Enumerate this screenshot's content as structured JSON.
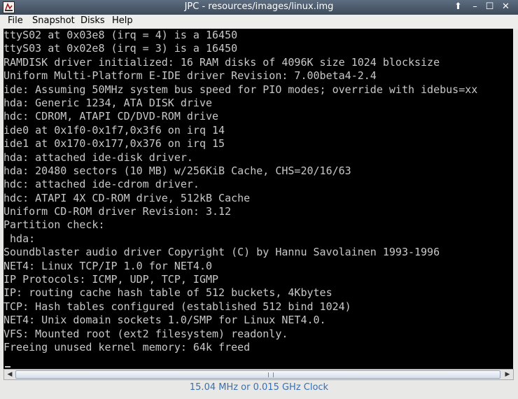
{
  "window": {
    "title": "JPC - resources/images/linux.img",
    "buttons": {
      "up": "⬆",
      "minimize": "–",
      "maximize": "☐",
      "close": "✕"
    }
  },
  "menu": {
    "file": "File",
    "snapshot": "Snapshot",
    "disks": "Disks",
    "help": "Help"
  },
  "console": {
    "lines": [
      "ttyS02 at 0x03e8 (irq = 4) is a 16450",
      "ttyS03 at 0x02e8 (irq = 3) is a 16450",
      "RAMDISK driver initialized: 16 RAM disks of 4096K size 1024 blocksize",
      "Uniform Multi-Platform E-IDE driver Revision: 7.00beta4-2.4",
      "ide: Assuming 50MHz system bus speed for PIO modes; override with idebus=xx",
      "hda: Generic 1234, ATA DISK drive",
      "hdc: CDROM, ATAPI CD/DVD-ROM drive",
      "ide0 at 0x1f0-0x1f7,0x3f6 on irq 14",
      "ide1 at 0x170-0x177,0x376 on irq 15",
      "hda: attached ide-disk driver.",
      "hda: 20480 sectors (10 MB) w/256KiB Cache, CHS=20/16/63",
      "hdc: attached ide-cdrom driver.",
      "hdc: ATAPI 4X CD-ROM drive, 512kB Cache",
      "Uniform CD-ROM driver Revision: 3.12",
      "Partition check:",
      " hda:",
      "Soundblaster audio driver Copyright (C) by Hannu Savolainen 1993-1996",
      "NET4: Linux TCP/IP 1.0 for NET4.0",
      "IP Protocols: ICMP, UDP, TCP, IGMP",
      "IP: routing cache hash table of 512 buckets, 4Kbytes",
      "TCP: Hash tables configured (established 512 bind 1024)",
      "NET4: Unix domain sockets 1.0/SMP for Linux NET4.0.",
      "VFS: Mounted root (ext2 filesystem) readonly.",
      "Freeing unused kernel memory: 64k freed"
    ],
    "foreground": "#c8c8c8",
    "background": "#000000"
  },
  "scrollbar": {
    "left_arrow": "◀",
    "right_arrow": "▶"
  },
  "status": {
    "clock": "15.04 MHz or 0.015 GHz Clock",
    "color": "#3a6fb0"
  }
}
